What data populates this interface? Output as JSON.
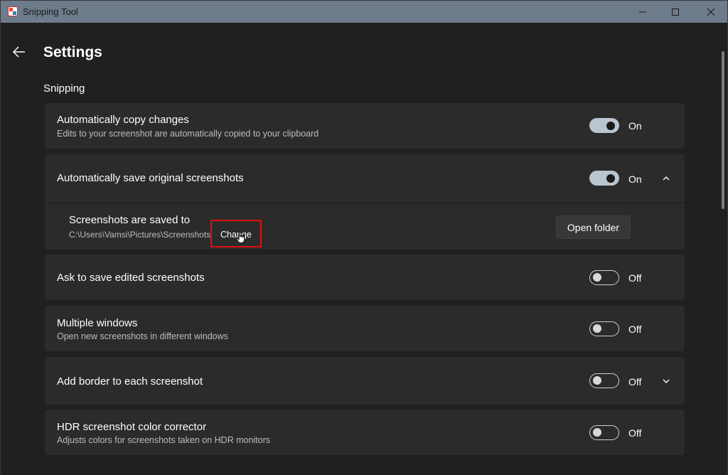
{
  "window": {
    "title": "Snipping Tool"
  },
  "header": {
    "title": "Settings"
  },
  "section": {
    "label": "Snipping"
  },
  "settings": {
    "auto_copy": {
      "title": "Automatically copy changes",
      "description": "Edits to your screenshot are automatically copied to your clipboard",
      "state": "On"
    },
    "auto_save": {
      "title": "Automatically save original screenshots",
      "state": "On",
      "save_location": {
        "label": "Screenshots are saved to",
        "path": "C:\\Users\\Vamsi\\Pictures\\Screenshots",
        "change_label": "Change",
        "open_folder_label": "Open folder"
      }
    },
    "ask_to_save": {
      "title": "Ask to save edited screenshots",
      "state": "Off"
    },
    "multiple_windows": {
      "title": "Multiple windows",
      "description": "Open new screenshots in different windows",
      "state": "Off"
    },
    "add_border": {
      "title": "Add border to each screenshot",
      "state": "Off"
    },
    "hdr": {
      "title": "HDR screenshot color corrector",
      "description": "Adjusts colors for screenshots taken on HDR monitors",
      "state": "Off"
    }
  },
  "colors": {
    "titlebar": "#6e7b8b",
    "background": "#202020",
    "card": "#2b2b2b",
    "toggle_on": "#b9c6d2",
    "highlight": "#e01010"
  },
  "icons": {
    "app": "snipping-tool-icon",
    "back": "back-arrow-icon",
    "expand": "chevron-up-icon",
    "collapse": "chevron-down-icon",
    "cursor": "hand-pointer-icon"
  }
}
